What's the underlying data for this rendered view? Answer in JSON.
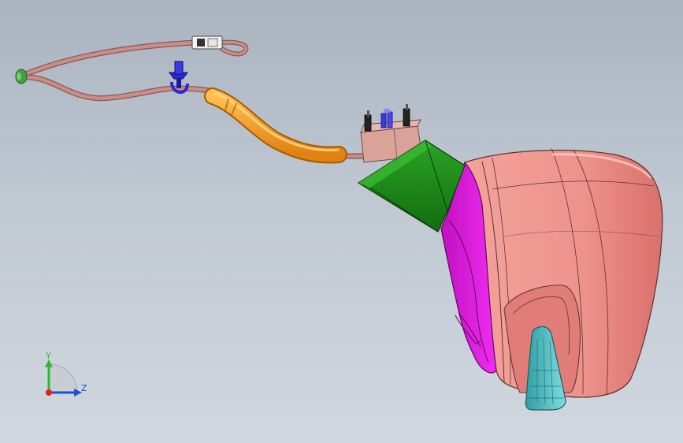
{
  "viewport": {
    "background_top": "#a9b3bf",
    "background_bottom": "#d0d7df"
  },
  "triad": {
    "y_label": "Y",
    "z_label": "Z",
    "y_color": "#2fb82f",
    "z_color": "#1f4fd6",
    "x_color": "#e02020"
  },
  "colors": {
    "housing_salmon": "#e98b86",
    "housing_magenta": "#ee1cee",
    "cover_green": "#1f8a1a",
    "connector_body": "#d9a39a",
    "hose_orange": "#f39a1a",
    "cable_brown": "#b87a74",
    "lens_cyan": "#4fc3c7",
    "clip_blue": "#2a2ad0",
    "end_green": "#3fa23f"
  }
}
